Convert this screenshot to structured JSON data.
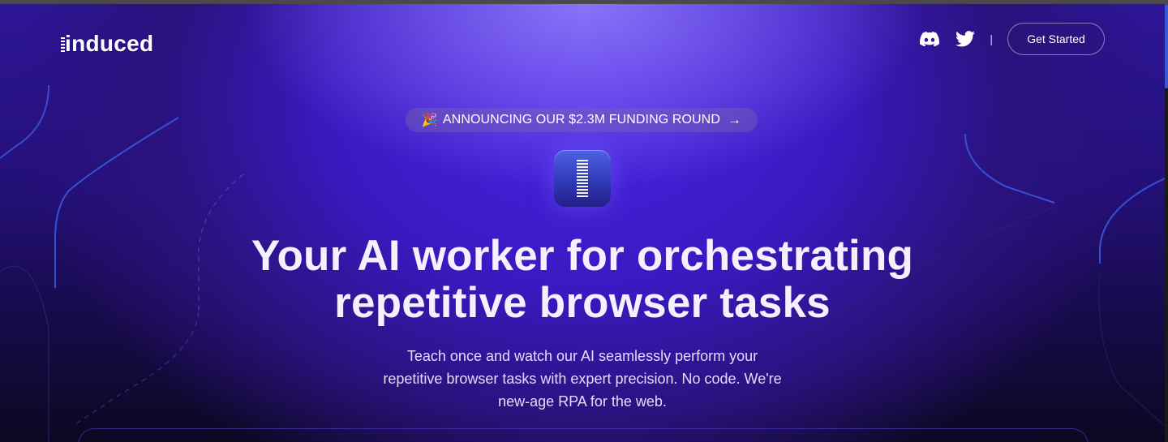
{
  "header": {
    "logo_text": "induced",
    "discord_icon": "discord-icon",
    "twitter_icon": "twitter-icon",
    "divider": "|",
    "cta_label": "Get Started"
  },
  "announcement": {
    "emoji": "🎉",
    "text": "ANNOUNCING OUR $2.3M FUNDING ROUND",
    "arrow": "→"
  },
  "hero": {
    "title_line1": "Your AI worker for orchestrating",
    "title_line2": "repetitive browser tasks",
    "subtitle_line1": "Teach once and watch our AI seamlessly perform your",
    "subtitle_line2": "repetitive browser tasks with expert precision. No code. We're",
    "subtitle_line3": "new-age RPA for the web."
  },
  "colors": {
    "background_purple": "#3a19c0",
    "accent_blue": "#3a58d8",
    "text_white": "#ffffff"
  }
}
